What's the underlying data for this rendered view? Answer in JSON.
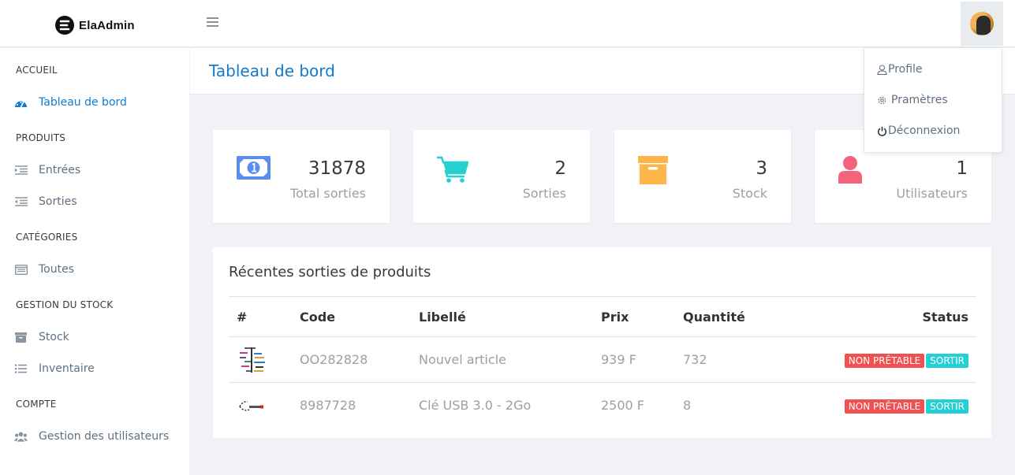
{
  "brand": {
    "name": "ElaAdmin"
  },
  "header": {
    "menu_toggle_icon": "hamburger-icon",
    "avatar_icon": "user-avatar"
  },
  "sidebar": {
    "sections": [
      {
        "title": "ACCUEIL",
        "items": [
          {
            "label": "Tableau de bord",
            "icon": "dashboard-icon",
            "active": true
          }
        ]
      },
      {
        "title": "PRODUITS",
        "items": [
          {
            "label": "Entrées",
            "icon": "indent-icon"
          },
          {
            "label": "Sorties",
            "icon": "outdent-icon"
          }
        ]
      },
      {
        "title": "CATÉGORIES",
        "items": [
          {
            "label": "Toutes",
            "icon": "list-alt-icon"
          }
        ]
      },
      {
        "title": "GESTION DU STOCK",
        "items": [
          {
            "label": "Stock",
            "icon": "archive-icon"
          },
          {
            "label": "Inventaire",
            "icon": "list-icon"
          }
        ]
      },
      {
        "title": "COMPTE",
        "items": [
          {
            "label": "Gestion des utilisateurs",
            "icon": "users-icon"
          }
        ]
      }
    ]
  },
  "page": {
    "title": "Tableau de bord"
  },
  "stats": [
    {
      "value": "31878",
      "label": "Total sorties",
      "icon": "money-icon",
      "color": "#5b8def"
    },
    {
      "value": "2",
      "label": "Sorties",
      "icon": "cart-icon",
      "color": "#27d0cf"
    },
    {
      "value": "3",
      "label": "Stock",
      "icon": "archive-box-icon",
      "color": "#ffb648"
    },
    {
      "value": "1",
      "label": "Utilisateurs",
      "icon": "user-icon",
      "color": "#f4637c"
    }
  ],
  "recent": {
    "title": "Récentes sorties de produits",
    "columns": [
      "#",
      "Code",
      "Libellé",
      "Prix",
      "Quantité",
      "Status"
    ],
    "rows": [
      {
        "code": "OO282828",
        "label": "Nouvel article",
        "price": "939 F",
        "qty": "732",
        "badge1": "NON PRÊTABLE",
        "badge2": "SORTIR"
      },
      {
        "code": "8987728",
        "label": "Clé USB 3.0 - 2Go",
        "price": "2500 F",
        "qty": "8",
        "badge1": "NON PRÊTABLE",
        "badge2": "SORTIR"
      }
    ]
  },
  "dropdown": {
    "items": [
      {
        "label": "Profile",
        "icon": "user-outline-icon"
      },
      {
        "label": "Pramètres",
        "icon": "gear-icon"
      },
      {
        "label": "Déconnexion",
        "icon": "power-icon"
      }
    ]
  },
  "colors": {
    "accent": "#0f7bcf",
    "badge_red": "#f05050",
    "badge_teal": "#24d0d3"
  }
}
